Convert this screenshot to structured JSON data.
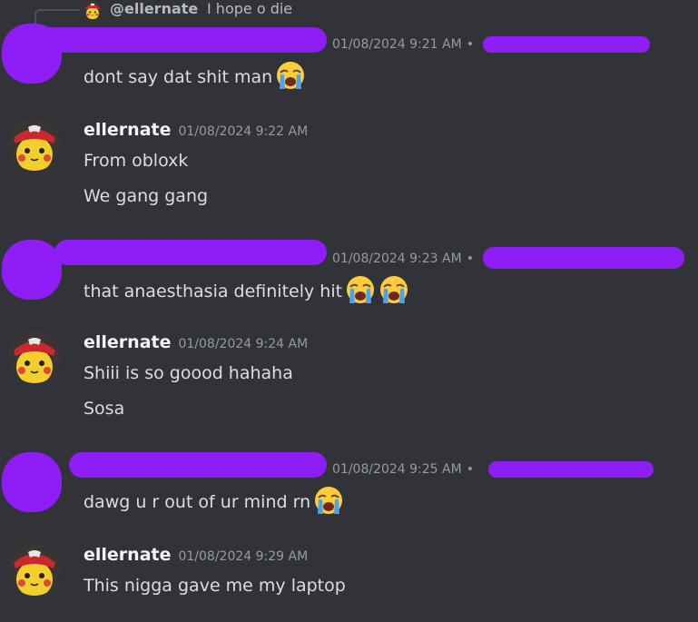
{
  "reply": {
    "author": "@ellernate",
    "text": "I hope o die"
  },
  "messages": [
    {
      "id": "m1",
      "author": "",
      "time": "01/08/2024 9:21 AM",
      "lines": [
        "dont say dat shit man"
      ],
      "emoji_counts": [
        1
      ],
      "redacted": true
    },
    {
      "id": "m2",
      "author": "ellernate",
      "time": "01/08/2024 9:22 AM",
      "lines": [
        "From obloxk",
        "We gang gang"
      ],
      "redacted": false
    },
    {
      "id": "m3",
      "author": "",
      "time": "01/08/2024 9:23 AM",
      "lines": [
        "that anaesthasia definitely hit"
      ],
      "emoji_counts": [
        2
      ],
      "redacted": true
    },
    {
      "id": "m4",
      "author": "ellernate",
      "time": "01/08/2024 9:24 AM",
      "lines": [
        "Shiii is so goood hahaha",
        "Sosa"
      ],
      "redacted": false
    },
    {
      "id": "m5",
      "author": "",
      "time": "01/08/2024 9:25 AM",
      "lines": [
        "dawg u r out of ur mind rn"
      ],
      "emoji_counts": [
        1
      ],
      "redacted": true
    },
    {
      "id": "m6",
      "author": "ellernate",
      "time": "01/08/2024 9:29 AM",
      "lines": [
        "This nigga gave me my laptop"
      ],
      "redacted": false
    }
  ],
  "icons": {
    "emoji": "loudly-crying-face-icon",
    "avatar": "pikachu-red-cap-avatar"
  },
  "colors": {
    "background": "#313338",
    "redaction": "#8f1df5",
    "username": "#f2f3f5",
    "timestamp": "#949ba4",
    "text": "#dbdee1"
  }
}
